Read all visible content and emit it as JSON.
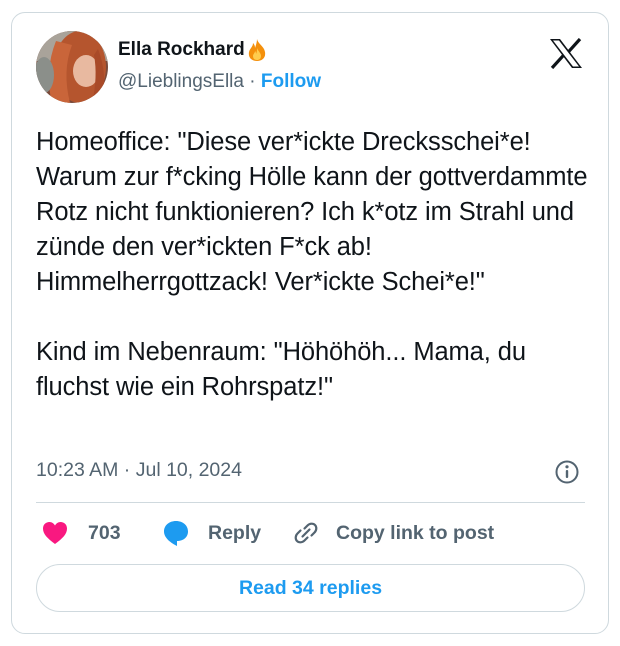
{
  "author": {
    "display_name": "Ella Rockhard",
    "name_emoji": "fire-icon",
    "handle": "@LieblingsElla",
    "separator": "·",
    "follow_label": "Follow"
  },
  "platform_logo": "x-logo-icon",
  "post": {
    "text": "Homeoffice: \"Diese ver*ickte Drecksschei*e! Warum zur f*cking Hölle kann der gottverdammte Rotz nicht funktionieren? Ich k*otz im Strahl und zünde den ver*ickten F*ck ab! Himmelherrgottzack! Ver*ickte Schei*e!\"\n\nKind im Nebenraum: \"Höhöhöh... Mama, du fluchst wie ein Rohrspatz!\"",
    "timestamp": "10:23 AM · Jul 10, 2024"
  },
  "actions": {
    "like_count": "703",
    "reply_label": "Reply",
    "copy_link_label": "Copy link to post"
  },
  "read_replies_label": "Read 34 replies",
  "colors": {
    "accent": "#1d9bf0",
    "like": "#f91880",
    "text": "#0f1419",
    "muted": "#536471",
    "border": "#cfd9de"
  }
}
